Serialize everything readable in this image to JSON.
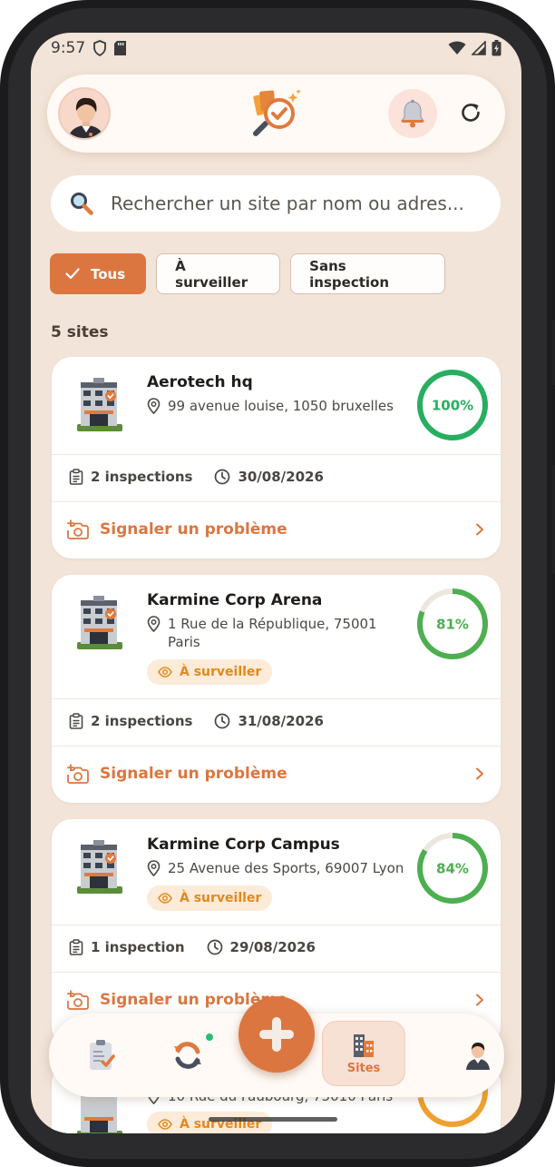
{
  "status_bar": {
    "time": "9:57"
  },
  "header": {
    "logo_icon": "inspection-logo-icon",
    "bell_icon": "bell-icon",
    "refresh_icon": "refresh-icon"
  },
  "search": {
    "placeholder": "Rechercher un site par nom ou adres..."
  },
  "filters": {
    "items": [
      {
        "label": "Tous",
        "active": true
      },
      {
        "label": "À surveiller",
        "active": false
      },
      {
        "label": "Sans inspection",
        "active": false
      }
    ]
  },
  "sites_count": "5 sites",
  "sites": [
    {
      "name": "Aerotech hq",
      "address": "99 avenue louise, 1050 bruxelles",
      "score_label": "100%",
      "score": 100,
      "badge": "",
      "inspections": "2 inspections",
      "date": "30/08/2026",
      "report": "Signaler un problème",
      "ring_color": "#27ae60"
    },
    {
      "name": "Karmine Corp Arena",
      "address": "1 Rue de la République, 75001 Paris",
      "score_label": "81%",
      "score": 81,
      "badge": "À surveiller",
      "inspections": "2 inspections",
      "date": "31/08/2026",
      "report": "Signaler un problème",
      "ring_color": "#4caf50"
    },
    {
      "name": "Karmine Corp Campus",
      "address": "25 Avenue des Sports, 69007 Lyon",
      "score_label": "84%",
      "score": 84,
      "badge": "À surveiller",
      "inspections": "1 inspection",
      "date": "29/08/2026",
      "report": "Signaler un problème",
      "ring_color": "#4caf50"
    },
    {
      "name": "",
      "address": "10 Rue du Faubourg, 75010 Paris",
      "score_label": "72%",
      "score": 72,
      "badge": "À surveiller",
      "inspections": "",
      "date": "",
      "report": "",
      "ring_color": "#f0a030"
    }
  ],
  "bottom_nav": {
    "items": [
      {
        "icon": "clipboard-check-icon"
      },
      {
        "icon": "sync-icon"
      },
      {
        "icon": "buildings-icon",
        "label": "Sites",
        "active": true
      },
      {
        "icon": "user-icon"
      }
    ],
    "fab_icon": "plus-icon"
  },
  "colors": {
    "accent": "#dc7640",
    "background": "#f2e4d8",
    "success": "#27ae60",
    "warning": "#e2891d"
  }
}
